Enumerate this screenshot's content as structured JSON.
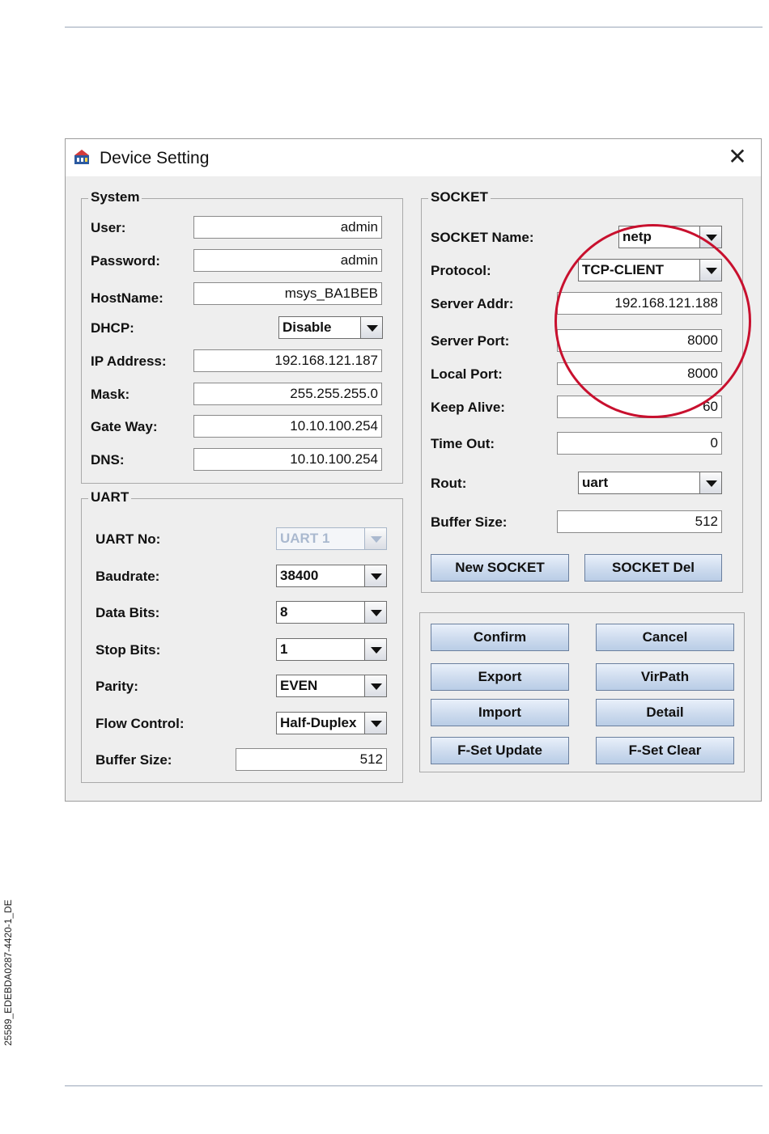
{
  "doc": {
    "side_code": "25589_EDEBDA0287-4420-1_DE"
  },
  "window": {
    "title": "Device Setting",
    "close_glyph": "✕",
    "icon": "app-icon"
  },
  "system": {
    "title": "System",
    "user_label": "User:",
    "user_value": "admin",
    "password_label": "Password:",
    "password_value": "admin",
    "hostname_label": "HostName:",
    "hostname_value": "msys_BA1BEB",
    "dhcp_label": "DHCP:",
    "dhcp_value": "Disable",
    "ip_label": "IP Address:",
    "ip_value": "192.168.121.187",
    "mask_label": "Mask:",
    "mask_value": "255.255.255.0",
    "gateway_label": "Gate Way:",
    "gateway_value": "10.10.100.254",
    "dns_label": "DNS:",
    "dns_value": "10.10.100.254"
  },
  "uart": {
    "title": "UART",
    "no_label": "UART No:",
    "no_value": "UART 1",
    "baud_label": "Baudrate:",
    "baud_value": "38400",
    "databits_label": "Data Bits:",
    "databits_value": "8",
    "stopbits_label": "Stop Bits:",
    "stopbits_value": "1",
    "parity_label": "Parity:",
    "parity_value": "EVEN",
    "flow_label": "Flow Control:",
    "flow_value": "Half-Duplex",
    "buffer_label": "Buffer Size:",
    "buffer_value": "512"
  },
  "socket": {
    "title": "SOCKET",
    "name_label": "SOCKET Name:",
    "name_value": "netp",
    "protocol_label": "Protocol:",
    "protocol_value": "TCP-CLIENT",
    "server_addr_label": "Server Addr:",
    "server_addr_value": "192.168.121.188",
    "server_port_label": "Server Port:",
    "server_port_value": "8000",
    "local_port_label": "Local Port:",
    "local_port_value": "8000",
    "keepalive_label": "Keep Alive:",
    "keepalive_value": "60",
    "timeout_label": "Time Out:",
    "timeout_value": "0",
    "rout_label": "Rout:",
    "rout_value": "uart",
    "buffer_label": "Buffer Size:",
    "buffer_value": "512",
    "new_button": "New SOCKET",
    "del_button": "SOCKET Del"
  },
  "actions": {
    "confirm": "Confirm",
    "cancel": "Cancel",
    "export": "Export",
    "virpath": "VirPath",
    "import": "Import",
    "detail": "Detail",
    "fset_update": "F-Set Update",
    "fset_clear": "F-Set Clear"
  },
  "colors": {
    "highlight": "#c8102e",
    "button_border": "#6a7f9e",
    "dialog_bg": "#eeeeee"
  }
}
